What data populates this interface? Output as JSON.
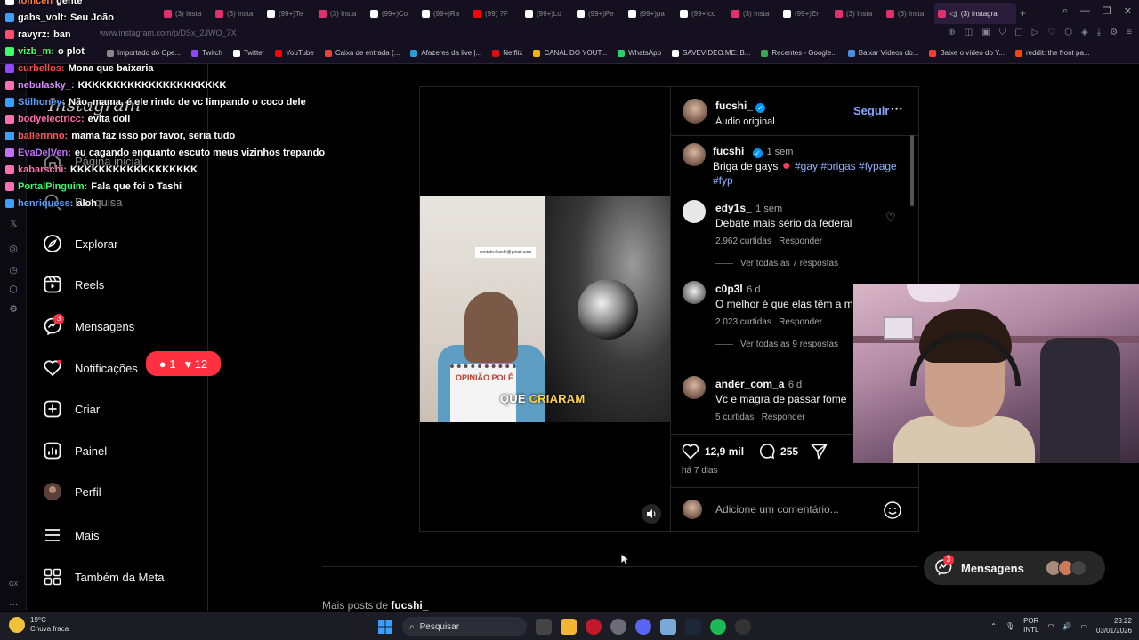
{
  "browser": {
    "tabs": [
      {
        "label": "(3) Insta",
        "color": "#e1306c"
      },
      {
        "label": "(3) Insta",
        "color": "#e1306c"
      },
      {
        "label": "(99+)Te",
        "color": "#ffffff"
      },
      {
        "label": "(3) Insta",
        "color": "#e1306c"
      },
      {
        "label": "(99+)Co",
        "color": "#ffffff"
      },
      {
        "label": "(99+)Ra",
        "color": "#ffffff"
      },
      {
        "label": "(99) ?F",
        "color": "#ff0000"
      },
      {
        "label": "(99+)Lo",
        "color": "#ffffff"
      },
      {
        "label": "(99+)Pe",
        "color": "#ffffff"
      },
      {
        "label": "(99+)pa",
        "color": "#ffffff"
      },
      {
        "label": "(99+)co",
        "color": "#ffffff"
      },
      {
        "label": "(3) Insta",
        "color": "#e1306c"
      },
      {
        "label": "(99+)Er",
        "color": "#ffffff"
      },
      {
        "label": "(3) Insta",
        "color": "#e1306c"
      },
      {
        "label": "(3) Insta",
        "color": "#e1306c"
      }
    ],
    "active_tab": "(3) Instagra",
    "new_tab": "+",
    "url": "www.instagram.com/p/DSx_2JWO_7X",
    "bookmarks": [
      {
        "label": "Importado do Ope...",
        "color": "#888888"
      },
      {
        "label": "Twitch",
        "color": "#9146ff"
      },
      {
        "label": "Twitter",
        "color": "#ffffff"
      },
      {
        "label": "YouTube",
        "color": "#ff0000"
      },
      {
        "label": "Caixa de entrada (...",
        "color": "#ea4335"
      },
      {
        "label": "Afazeres da live |...",
        "color": "#2d9cdb"
      },
      {
        "label": "Netflix",
        "color": "#e50914"
      },
      {
        "label": "CANAL DO YOUT...",
        "color": "#f4b400"
      },
      {
        "label": "WhatsApp",
        "color": "#25d366"
      },
      {
        "label": "SAVEVIDEO.ME: B...",
        "color": "#ffffff"
      },
      {
        "label": "Recentes - Google...",
        "color": "#34a853"
      },
      {
        "label": "Baixar Vídeos do...",
        "color": "#4a90e2"
      },
      {
        "label": "Baixe o vídeo do Y...",
        "color": "#ff3b30"
      },
      {
        "label": "reddit: the front pa...",
        "color": "#ff4500"
      }
    ]
  },
  "chat": [
    {
      "user": "tomcen",
      "text": "gente",
      "color": "#ff7f50"
    },
    {
      "user": "gabs_volt:",
      "text": "Seu João",
      "color": "#ffffff"
    },
    {
      "user": "ravyrz:",
      "text": "ban",
      "color": "#ffffff"
    },
    {
      "user": "vizb_m:",
      "text": "o plot",
      "color": "#3cff6a"
    },
    {
      "user": "curbellos:",
      "text": "Mona que baixaria",
      "color": "#ff4d4d"
    },
    {
      "user": "nebulasky_:",
      "text": "KKKKKKKKKKKKKKKKKKKKK",
      "color": "#d98cff"
    },
    {
      "user": "Stilhoney:",
      "text": "Não, mama, é ele rindo de vc limpando o coco dele",
      "color": "#5aa0ff"
    },
    {
      "user": "bodyelectricc:",
      "text": "evita doll",
      "color": "#ff6fb1"
    },
    {
      "user": "ballerinno:",
      "text": "mama faz isso por favor, seria tudo",
      "color": "#ff5a5a"
    },
    {
      "user": "EvaDelVen:",
      "text": "eu cagando enquanto escuto meus vizinhos trepando",
      "color": "#c470ff"
    },
    {
      "user": "kabarschi:",
      "text": "KKKKKKKKKKKKKKKKKK",
      "color": "#ff6fb1"
    },
    {
      "user": "PortalPinguim:",
      "text": "Fala que foi o Tashi",
      "color": "#3cff6a"
    },
    {
      "user": "henriquess:",
      "text": "aloh",
      "color": "#5aa0ff"
    }
  ],
  "instagram": {
    "logo": "Instagram",
    "nav": [
      {
        "label": "Página inicial",
        "icon": "home-icon"
      },
      {
        "label": "Pesquisa",
        "icon": "search-icon"
      },
      {
        "label": "Explorar",
        "icon": "compass-icon"
      },
      {
        "label": "Reels",
        "icon": "reels-icon"
      },
      {
        "label": "Mensagens",
        "icon": "messenger-icon"
      },
      {
        "label": "Notificações",
        "icon": "heart-icon"
      },
      {
        "label": "Criar",
        "icon": "plus-square-icon"
      },
      {
        "label": "Painel",
        "icon": "chart-icon"
      },
      {
        "label": "Perfil",
        "icon": "avatar"
      },
      {
        "label": "Mais",
        "icon": "menu-icon"
      },
      {
        "label": "Também da Meta",
        "icon": "grid-icon"
      }
    ],
    "messages_badge": "3",
    "notif_popup": {
      "comments": "1",
      "likes": "12"
    }
  },
  "post": {
    "author": "fucshi_",
    "audio": "Áudio original",
    "follow": "Seguir",
    "caption_time": "1 sem",
    "caption_text": "Briga de gays",
    "caption_tags": "#gay #brigas #fypage #fyp",
    "video_caption_a": "QUE",
    "video_caption_b": "CRIARAM",
    "video_email": "contato.fucshi@gmail.com",
    "notebook_text": "OPINIÃO POLÊ",
    "comments": [
      {
        "user": "edy1s_",
        "time": "1 sem",
        "text": "Debate mais sério da federal",
        "likes": "2.962 curtidas",
        "reply": "Responder",
        "view_replies": "Ver todas as 7 respostas"
      },
      {
        "user": "c0p3l",
        "time": "6 d",
        "text": "O melhor é que elas têm a mesma voz",
        "likes": "2.023 curtidas",
        "reply": "Responder",
        "view_replies": "Ver todas as 9 respostas"
      },
      {
        "user": "ander_com_a",
        "time": "6 d",
        "text": "Vc e magra de passar fome",
        "likes": "5 curtidas",
        "reply": "Responder",
        "view_replies": ""
      }
    ],
    "likes": "12,9 mil",
    "comment_count": "255",
    "date": "há 7 dias",
    "comment_placeholder": "Adicione um comentário..."
  },
  "more_posts_prefix": "Mais posts de",
  "more_posts_user": "fucshi_",
  "messages_pill": {
    "label": "Mensagens",
    "badge": "3"
  },
  "taskbar": {
    "weather_temp": "19°C",
    "weather_desc": "Chuva fraca",
    "search": "Pesquisar",
    "lang": "POR",
    "layout": "INTL",
    "time": "23:22",
    "date": "03/01/2026"
  },
  "opera_side_label": "GX"
}
